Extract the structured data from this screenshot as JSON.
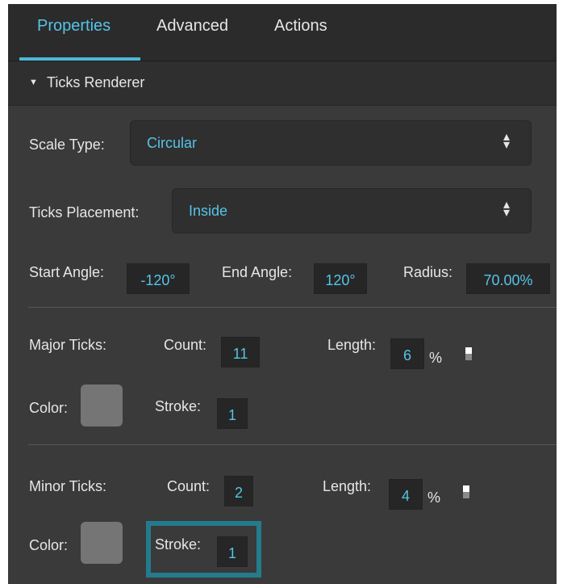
{
  "tabs": [
    {
      "label": "Properties",
      "active": true
    },
    {
      "label": "Advanced",
      "active": false
    },
    {
      "label": "Actions",
      "active": false
    }
  ],
  "section": {
    "title": "Ticks Renderer",
    "expand_icon": "triangle-down-icon"
  },
  "scale_type": {
    "label": "Scale Type:",
    "value": "Circular"
  },
  "ticks_placement": {
    "label": "Ticks Placement:",
    "value": "Inside"
  },
  "angles": {
    "start_label": "Start Angle:",
    "start_value": "-120°",
    "end_label": "End Angle:",
    "end_value": "120°",
    "radius_label": "Radius:",
    "radius_value": "70.00%"
  },
  "major": {
    "label": "Major Ticks:",
    "count_label": "Count:",
    "count_value": "11",
    "length_label": "Length:",
    "length_value": "6",
    "length_unit": "%",
    "color_label": "Color:",
    "stroke_label": "Stroke:",
    "stroke_value": "1"
  },
  "minor": {
    "label": "Minor Ticks:",
    "count_label": "Count:",
    "count_value": "2",
    "length_label": "Length:",
    "length_value": "4",
    "length_unit": "%",
    "color_label": "Color:",
    "stroke_label": "Stroke:",
    "stroke_value": "1"
  },
  "colors": {
    "accent": "#55c4e6",
    "panel_bg": "#3a3a3a",
    "tabbar_bg": "#2b2b2b",
    "swatch": "#757575",
    "highlight": "#237b8d"
  }
}
